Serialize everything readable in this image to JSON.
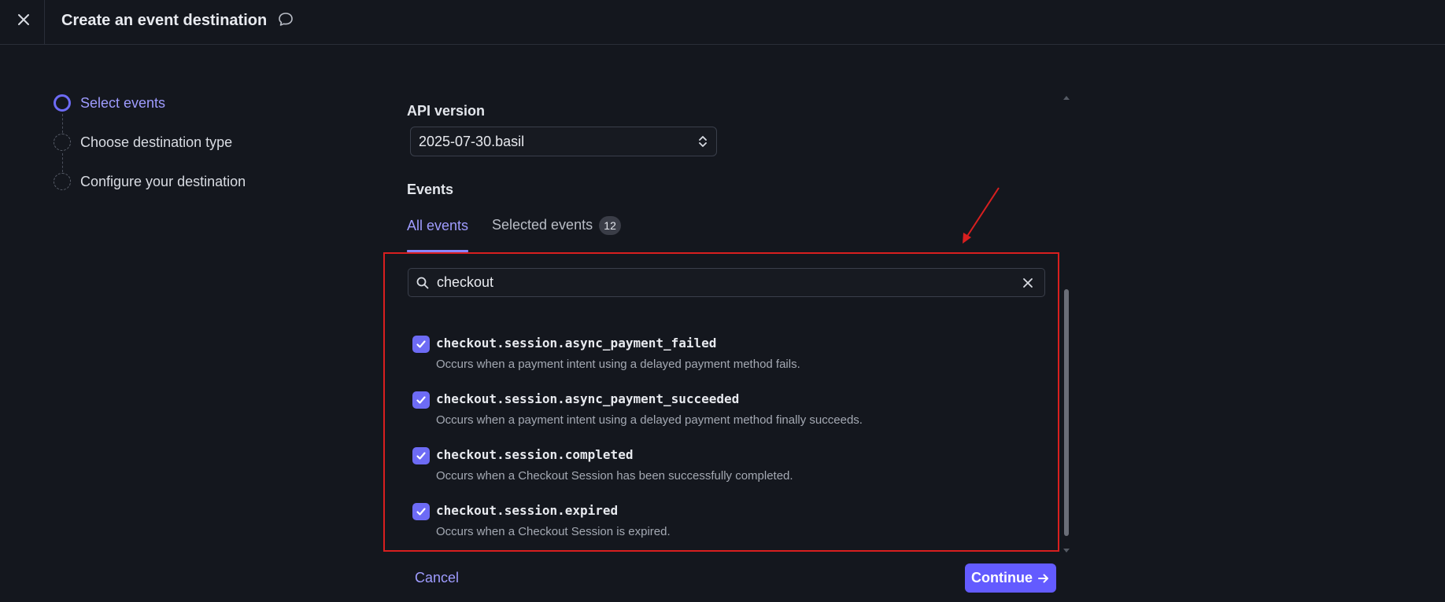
{
  "header": {
    "title": "Create an event destination"
  },
  "stepper": {
    "steps": [
      {
        "label": "Select events",
        "state": "active"
      },
      {
        "label": "Choose destination type",
        "state": "pending"
      },
      {
        "label": "Configure your destination",
        "state": "pending"
      }
    ]
  },
  "api_version": {
    "label": "API version",
    "value": "2025-07-30.basil"
  },
  "events": {
    "label": "Events",
    "tabs": [
      {
        "label": "All events",
        "active": true
      },
      {
        "label": "Selected events",
        "count": "12",
        "active": false
      }
    ],
    "search": {
      "value": "checkout"
    },
    "items": [
      {
        "name": "checkout.session.async_payment_failed",
        "description": "Occurs when a payment intent using a delayed payment method fails.",
        "checked": true
      },
      {
        "name": "checkout.session.async_payment_succeeded",
        "description": "Occurs when a payment intent using a delayed payment method finally succeeds.",
        "checked": true
      },
      {
        "name": "checkout.session.completed",
        "description": "Occurs when a Checkout Session has been successfully completed.",
        "checked": true
      },
      {
        "name": "checkout.session.expired",
        "description": "Occurs when a Checkout Session is expired.",
        "checked": true
      }
    ]
  },
  "footer": {
    "cancel_label": "Cancel",
    "continue_label": "Continue"
  },
  "colors": {
    "background": "#14171e",
    "accent": "#635bff",
    "accent_text": "#9f9cff",
    "annotation": "#d81f1f"
  }
}
